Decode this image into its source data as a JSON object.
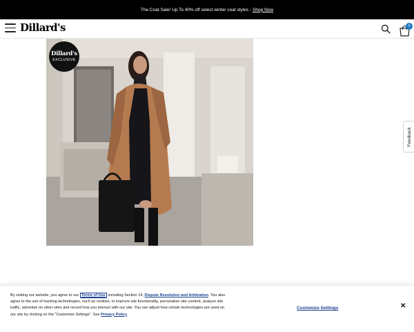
{
  "promo": {
    "text": "The Coat Sale! Up To 40% off select winter coat styles -",
    "link": "Shop Now"
  },
  "header": {
    "logo": "Dillard's",
    "cart_count": "0"
  },
  "hero": {
    "badge_brand": "Dillard's",
    "badge_label": "EXCLUSIVE"
  },
  "feedback": {
    "label": "Feedback"
  },
  "consent": {
    "text_1": "By visiting our website, you agree to our",
    "terms_link": "Terms of Use",
    "text_2": "including Section 14,",
    "dispute_link": "Dispute Resolution and Arbitration",
    "text_3": ". You also agree to the use of tracking technologies, such as cookies, to improve site functionality, personalize site content, analyze site traffic, advertise on other sites and record how you interact with our site. You can adjust how certain technologies are used on our site by clicking on the \"Customize Settings\". See",
    "privacy_link": "Privacy Policy",
    "text_4": ".",
    "customize_label": "Customize Settings",
    "close_label": "✕"
  },
  "colors": {
    "promo_bg": "#000000",
    "link_blue": "#1a3f8f",
    "cart_badge": "#1a76c2"
  }
}
